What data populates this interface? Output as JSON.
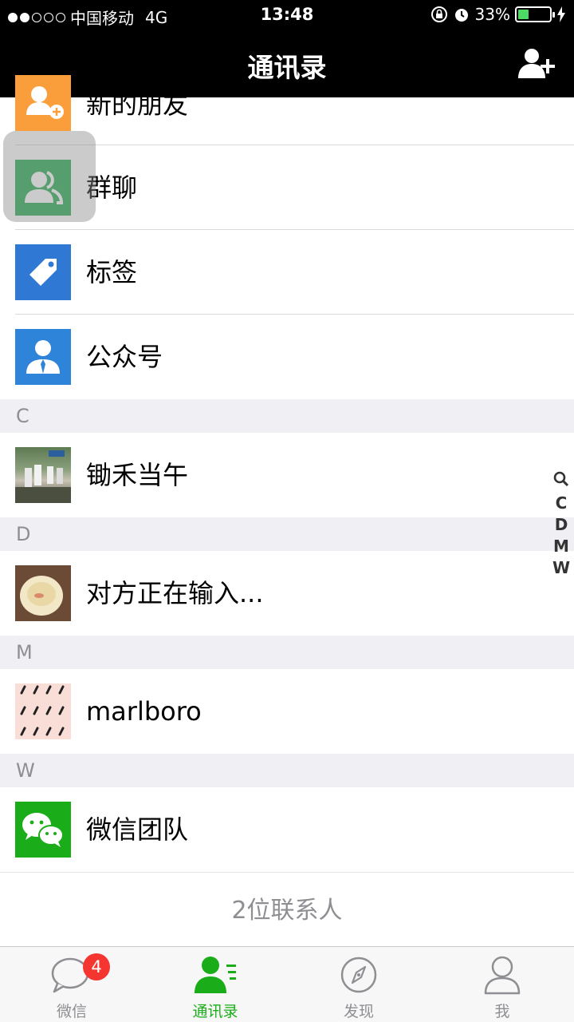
{
  "status_bar": {
    "carrier": "中国移动",
    "network": "4G",
    "time": "13:48",
    "battery_percent": "33%",
    "battery_level": 0.33,
    "signal_bars": 2
  },
  "nav": {
    "title": "通讯录",
    "add_icon": "add-friend-icon"
  },
  "special_entries": [
    {
      "label": "新的朋友",
      "icon": "new-friend-icon",
      "color": "#fa9d3b"
    },
    {
      "label": "群聊",
      "icon": "group-chat-icon",
      "color": "#2bad56"
    },
    {
      "label": "标签",
      "icon": "tag-icon",
      "color": "#2f78d3"
    },
    {
      "label": "公众号",
      "icon": "official-account-icon",
      "color": "#2d84d8"
    }
  ],
  "sections": [
    {
      "letter": "C",
      "contacts": [
        {
          "name": "锄禾当午"
        }
      ]
    },
    {
      "letter": "D",
      "contacts": [
        {
          "name": "对方正在输入..."
        }
      ]
    },
    {
      "letter": "M",
      "contacts": [
        {
          "name": "marlboro"
        }
      ]
    },
    {
      "letter": "W",
      "contacts": [
        {
          "name": "微信团队"
        }
      ]
    }
  ],
  "contact_count": "2位联系人",
  "index_bar": [
    "C",
    "D",
    "M",
    "W"
  ],
  "tabs": [
    {
      "label": "微信",
      "icon": "chat-bubble-icon",
      "badge": "4",
      "active": false
    },
    {
      "label": "通讯录",
      "icon": "contacts-icon",
      "active": true
    },
    {
      "label": "发现",
      "icon": "compass-icon",
      "active": false
    },
    {
      "label": "我",
      "icon": "person-icon",
      "active": false
    }
  ],
  "colors": {
    "accent": "#1aad19",
    "section_bg": "#efeff4",
    "badge": "#f43530"
  }
}
